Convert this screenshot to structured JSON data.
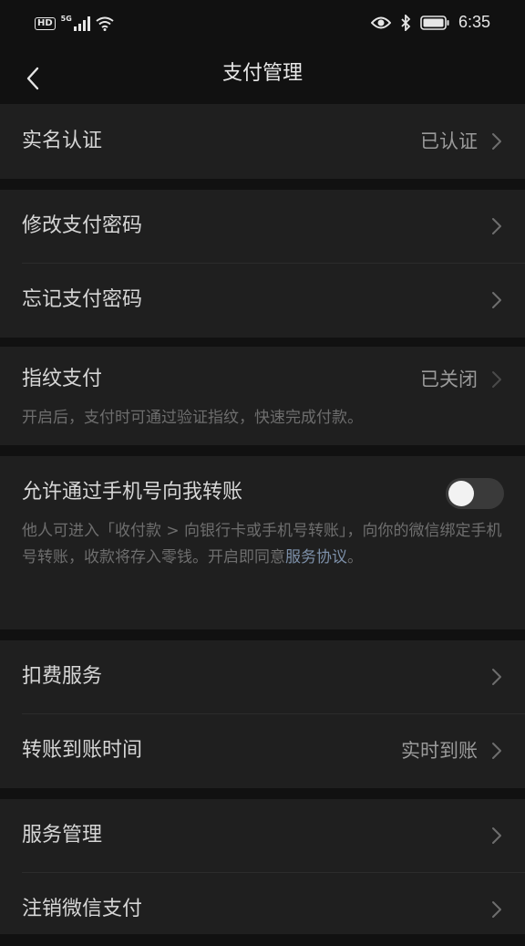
{
  "status_bar": {
    "hd": "HD",
    "network": "5G",
    "time": "6:35"
  },
  "header": {
    "title": "支付管理"
  },
  "groups": {
    "real_name": {
      "label": "实名认证",
      "value": "已认证"
    },
    "password": {
      "change_label": "修改支付密码",
      "forgot_label": "忘记支付密码"
    },
    "fingerprint": {
      "label": "指纹支付",
      "value": "已关闭",
      "description": "开启后，支付时可通过验证指纹，快速完成付款。"
    },
    "phone_transfer": {
      "label": "允许通过手机号向我转账",
      "toggle_on": false,
      "description": "他人可进入「收付款 > 向银行卡或手机号转账」，向你的微信绑定手机号转账，收款将存入零钱。开启即同意",
      "link": "服务协议",
      "description_end": "。"
    },
    "deduction": {
      "label": "扣费服务"
    },
    "transfer_time": {
      "label": "转账到账时间",
      "value": "实时到账"
    },
    "service": {
      "manage_label": "服务管理",
      "cancel_label": "注销微信支付"
    }
  },
  "colors": {
    "background": "#111111",
    "card": "#1f1f1f",
    "link": "#7d90a9"
  }
}
